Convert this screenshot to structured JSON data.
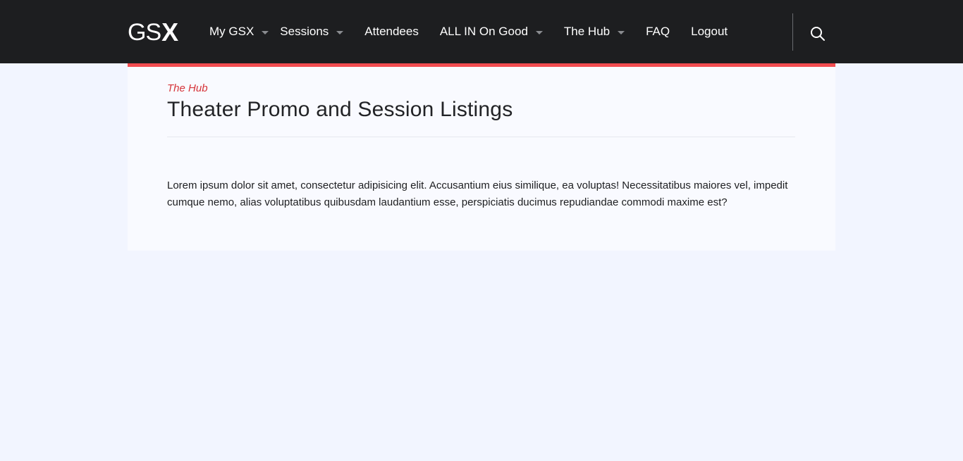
{
  "header": {
    "logo": {
      "text": "GS",
      "accent": "X"
    },
    "nav": [
      {
        "label": "My GSX",
        "dropdown": true
      },
      {
        "label": "Sessions",
        "dropdown": true
      },
      {
        "label": "Attendees",
        "dropdown": false
      },
      {
        "label": "ALL IN On Good",
        "dropdown": true
      },
      {
        "label": "The Hub",
        "dropdown": true
      },
      {
        "label": "FAQ",
        "dropdown": false
      },
      {
        "label": "Logout",
        "dropdown": false
      }
    ],
    "search_icon": "search-icon"
  },
  "main": {
    "breadcrumb": "The Hub",
    "title": "Theater Promo and Session Listings",
    "body": "Lorem ipsum dolor sit amet, consectetur adipisicing elit. Accusantium eius similique, ea voluptas! Necessitatibus maiores vel, impedit cumque nemo, alias voluptatibus quibusdam laudantium esse, perspiciatis ducimus repudiandae commodi maxime est?"
  },
  "colors": {
    "header_bg": "#1d1e20",
    "accent_red": "#f24c50",
    "breadcrumb_red": "#d6343a",
    "page_bg": "#f2f5ff",
    "card_bg": "#f9faff"
  }
}
